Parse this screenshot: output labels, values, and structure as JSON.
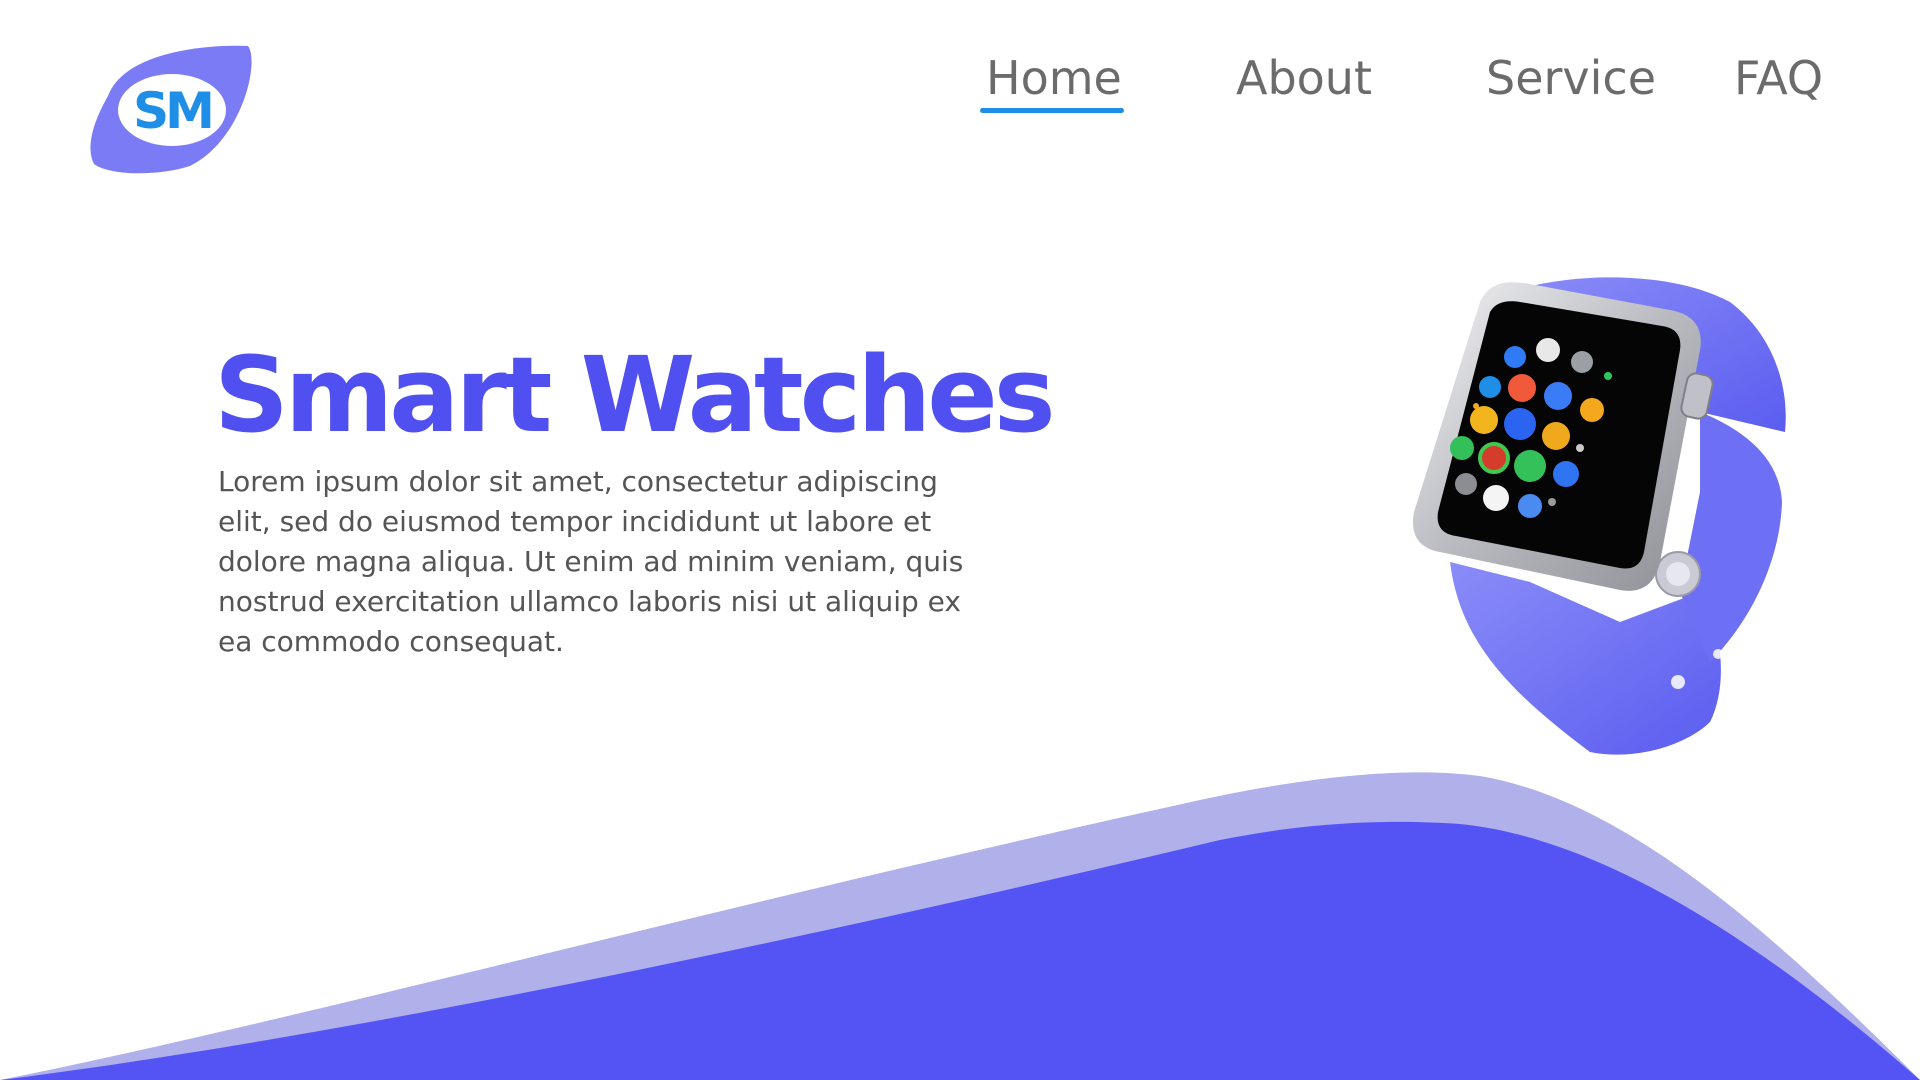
{
  "brand": {
    "logo_text": "SM",
    "logo_color": "#7b7cf5",
    "logo_text_color": "#1f8ee6"
  },
  "nav": {
    "items": [
      {
        "label": "Home",
        "active": true
      },
      {
        "label": "About",
        "active": false
      },
      {
        "label": "Service",
        "active": false
      },
      {
        "label": "FAQ",
        "active": false
      }
    ],
    "active_underline_color": "#1f8ee6"
  },
  "hero": {
    "title": "Smart Watches",
    "title_color": "#5050f0",
    "description": "Lorem ipsum dolor sit amet, consectetur adipiscing elit, sed do eiusmod tempor incididunt ut labore et dolore magna aliqua. Ut enim ad minim veniam, quis nostrud exercitation ullamco laboris nisi ut aliquip ex ea commodo consequat."
  },
  "product_image": {
    "icon": "smartwatch-image",
    "band_color": "#7b7cf5"
  },
  "wave": {
    "front_color": "#5454f5",
    "back_color": "#b0b0ea"
  }
}
